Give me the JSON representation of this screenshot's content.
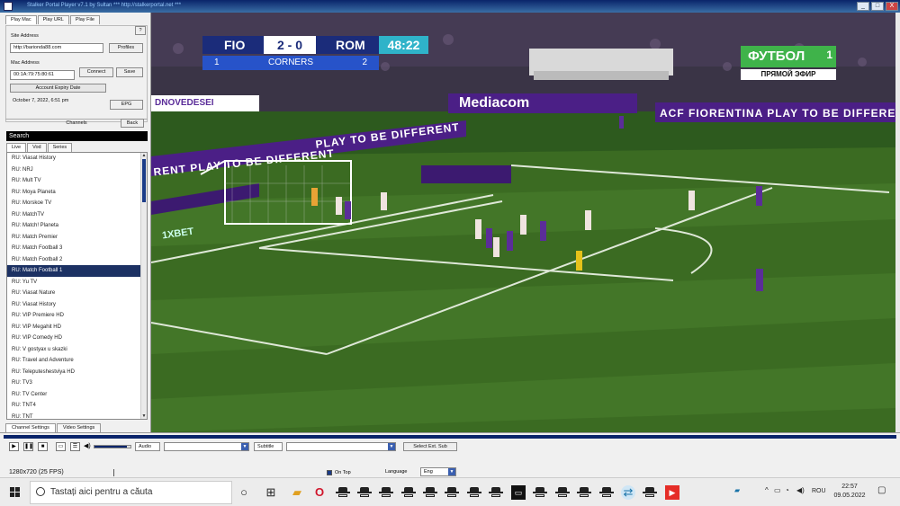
{
  "window": {
    "title": "Stalker Portal Player v7.1 by Sultan  ***  http://stalkerportal.net  ***",
    "minimize": "_",
    "maximize": "□",
    "close": "X"
  },
  "top_tabs": [
    "Play Mac",
    "Play URL",
    "Play File"
  ],
  "help_label": "?",
  "portal": {
    "site_label": "Site Address",
    "site_value": "http://barionda88.com",
    "profiles_label": "Profiles",
    "mac_label": "Mac Address",
    "mac_value": "00:1A:79:75:80:61",
    "connect_label": "Connect",
    "save_label": "Save",
    "expiry_label": "Account Expiry Date",
    "expiry_value": "October 7, 2022, 6:51 pm",
    "epg_label": "EPG"
  },
  "channels": {
    "header": "Channels",
    "back_label": "Back",
    "search_placeholder": "Search",
    "tabs": [
      "Live",
      "Vod",
      "Series"
    ],
    "items": [
      "RU: Viasat History",
      "RU: NRJ",
      "RU: Mult TV",
      "RU: Moya Planeta",
      "RU: Morskoe TV",
      "RU: MatchTV",
      "RU: Match! Planeta",
      "RU: Match Premier",
      "RU: Match Football 3",
      "RU: Match Football 2",
      "RU: Match Football 1",
      "RU: Yu TV",
      "RU: Viasat Nature",
      "RU: Viasat History",
      "RU: VIP Premiere HD",
      "RU: VIP Megahit HD",
      "RU: VIP Comedy HD",
      "RU: V gostyax u skazki",
      "RU: Travel and Adventure",
      "RU: Teleputeshestviya HD",
      "RU: TV3",
      "RU: TV Center",
      "RU: TNT4",
      "RU: TNT"
    ],
    "selected_index": 10,
    "bottom_tabs": [
      "Channel Settings",
      "Video Settings"
    ]
  },
  "scoreboard": {
    "home": "FIO",
    "score": "2 - 0",
    "away": "ROM",
    "time": "48:22",
    "home_count": "1",
    "stat_label": "CORNERS",
    "away_count": "2"
  },
  "channel_logo": {
    "name": "ФУТБОЛ",
    "number": "1",
    "live": "ПРЯМОЙ ЭФИР"
  },
  "stadium_text": {
    "mediacom": "Mediacom",
    "ad1": "ACF FIORENTINA  PLAY TO BE DIFFEREN",
    "ad2": "PLAY TO BE DIFFERENT",
    "ad3": "RENT PLAY TO BE DIFFERENT",
    "bet": "1XBET",
    "seats": "DNOVEDESEI"
  },
  "controls": {
    "audio_label": "Audio",
    "subtitle_label": "Subtitle",
    "select_ext_sub": "Select Ext. Sub",
    "resolution": "1280x720  (25 FPS)",
    "on_top": "On Top",
    "language_label": "Language",
    "language_value": "Eng",
    "volume_percent": 90
  },
  "taskbar": {
    "search_placeholder": "Tastați aici pentru a căuta",
    "lang": "ROU",
    "time": "22:57",
    "date": "09.05.2022"
  },
  "colors": {
    "title_bar": "#0a246a",
    "selected_row": "#1c3163",
    "pitch": "#3b6b22",
    "fiorentina_purple": "#4b1f86",
    "score_blue": "#1b2c7a",
    "time_teal": "#2fb3c9"
  }
}
